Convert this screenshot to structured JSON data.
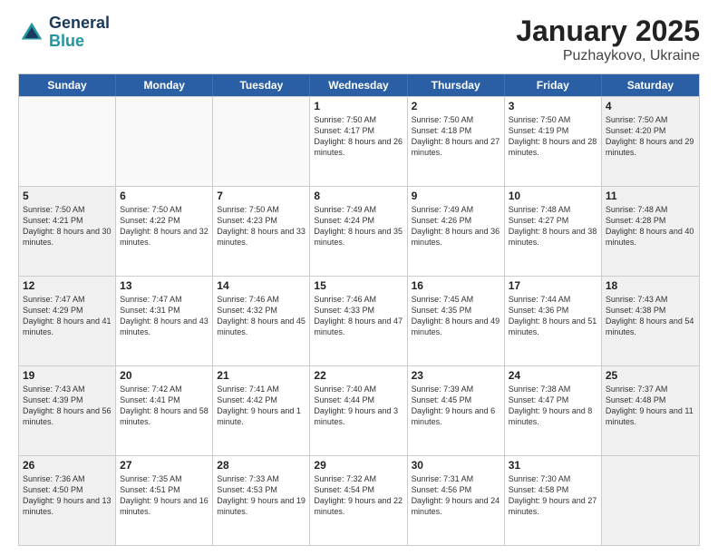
{
  "logo": {
    "line1": "General",
    "line2": "Blue"
  },
  "title": "January 2025",
  "subtitle": "Puzhaykovo, Ukraine",
  "header_days": [
    "Sunday",
    "Monday",
    "Tuesday",
    "Wednesday",
    "Thursday",
    "Friday",
    "Saturday"
  ],
  "rows": [
    [
      {
        "day": "",
        "info": "",
        "shaded": false,
        "empty": true
      },
      {
        "day": "",
        "info": "",
        "shaded": false,
        "empty": true
      },
      {
        "day": "",
        "info": "",
        "shaded": false,
        "empty": true
      },
      {
        "day": "1",
        "info": "Sunrise: 7:50 AM\nSunset: 4:17 PM\nDaylight: 8 hours and 26 minutes.",
        "shaded": false,
        "empty": false
      },
      {
        "day": "2",
        "info": "Sunrise: 7:50 AM\nSunset: 4:18 PM\nDaylight: 8 hours and 27 minutes.",
        "shaded": false,
        "empty": false
      },
      {
        "day": "3",
        "info": "Sunrise: 7:50 AM\nSunset: 4:19 PM\nDaylight: 8 hours and 28 minutes.",
        "shaded": false,
        "empty": false
      },
      {
        "day": "4",
        "info": "Sunrise: 7:50 AM\nSunset: 4:20 PM\nDaylight: 8 hours and 29 minutes.",
        "shaded": true,
        "empty": false
      }
    ],
    [
      {
        "day": "5",
        "info": "Sunrise: 7:50 AM\nSunset: 4:21 PM\nDaylight: 8 hours and 30 minutes.",
        "shaded": true,
        "empty": false
      },
      {
        "day": "6",
        "info": "Sunrise: 7:50 AM\nSunset: 4:22 PM\nDaylight: 8 hours and 32 minutes.",
        "shaded": false,
        "empty": false
      },
      {
        "day": "7",
        "info": "Sunrise: 7:50 AM\nSunset: 4:23 PM\nDaylight: 8 hours and 33 minutes.",
        "shaded": false,
        "empty": false
      },
      {
        "day": "8",
        "info": "Sunrise: 7:49 AM\nSunset: 4:24 PM\nDaylight: 8 hours and 35 minutes.",
        "shaded": false,
        "empty": false
      },
      {
        "day": "9",
        "info": "Sunrise: 7:49 AM\nSunset: 4:26 PM\nDaylight: 8 hours and 36 minutes.",
        "shaded": false,
        "empty": false
      },
      {
        "day": "10",
        "info": "Sunrise: 7:48 AM\nSunset: 4:27 PM\nDaylight: 8 hours and 38 minutes.",
        "shaded": false,
        "empty": false
      },
      {
        "day": "11",
        "info": "Sunrise: 7:48 AM\nSunset: 4:28 PM\nDaylight: 8 hours and 40 minutes.",
        "shaded": true,
        "empty": false
      }
    ],
    [
      {
        "day": "12",
        "info": "Sunrise: 7:47 AM\nSunset: 4:29 PM\nDaylight: 8 hours and 41 minutes.",
        "shaded": true,
        "empty": false
      },
      {
        "day": "13",
        "info": "Sunrise: 7:47 AM\nSunset: 4:31 PM\nDaylight: 8 hours and 43 minutes.",
        "shaded": false,
        "empty": false
      },
      {
        "day": "14",
        "info": "Sunrise: 7:46 AM\nSunset: 4:32 PM\nDaylight: 8 hours and 45 minutes.",
        "shaded": false,
        "empty": false
      },
      {
        "day": "15",
        "info": "Sunrise: 7:46 AM\nSunset: 4:33 PM\nDaylight: 8 hours and 47 minutes.",
        "shaded": false,
        "empty": false
      },
      {
        "day": "16",
        "info": "Sunrise: 7:45 AM\nSunset: 4:35 PM\nDaylight: 8 hours and 49 minutes.",
        "shaded": false,
        "empty": false
      },
      {
        "day": "17",
        "info": "Sunrise: 7:44 AM\nSunset: 4:36 PM\nDaylight: 8 hours and 51 minutes.",
        "shaded": false,
        "empty": false
      },
      {
        "day": "18",
        "info": "Sunrise: 7:43 AM\nSunset: 4:38 PM\nDaylight: 8 hours and 54 minutes.",
        "shaded": true,
        "empty": false
      }
    ],
    [
      {
        "day": "19",
        "info": "Sunrise: 7:43 AM\nSunset: 4:39 PM\nDaylight: 8 hours and 56 minutes.",
        "shaded": true,
        "empty": false
      },
      {
        "day": "20",
        "info": "Sunrise: 7:42 AM\nSunset: 4:41 PM\nDaylight: 8 hours and 58 minutes.",
        "shaded": false,
        "empty": false
      },
      {
        "day": "21",
        "info": "Sunrise: 7:41 AM\nSunset: 4:42 PM\nDaylight: 9 hours and 1 minute.",
        "shaded": false,
        "empty": false
      },
      {
        "day": "22",
        "info": "Sunrise: 7:40 AM\nSunset: 4:44 PM\nDaylight: 9 hours and 3 minutes.",
        "shaded": false,
        "empty": false
      },
      {
        "day": "23",
        "info": "Sunrise: 7:39 AM\nSunset: 4:45 PM\nDaylight: 9 hours and 6 minutes.",
        "shaded": false,
        "empty": false
      },
      {
        "day": "24",
        "info": "Sunrise: 7:38 AM\nSunset: 4:47 PM\nDaylight: 9 hours and 8 minutes.",
        "shaded": false,
        "empty": false
      },
      {
        "day": "25",
        "info": "Sunrise: 7:37 AM\nSunset: 4:48 PM\nDaylight: 9 hours and 11 minutes.",
        "shaded": true,
        "empty": false
      }
    ],
    [
      {
        "day": "26",
        "info": "Sunrise: 7:36 AM\nSunset: 4:50 PM\nDaylight: 9 hours and 13 minutes.",
        "shaded": true,
        "empty": false
      },
      {
        "day": "27",
        "info": "Sunrise: 7:35 AM\nSunset: 4:51 PM\nDaylight: 9 hours and 16 minutes.",
        "shaded": false,
        "empty": false
      },
      {
        "day": "28",
        "info": "Sunrise: 7:33 AM\nSunset: 4:53 PM\nDaylight: 9 hours and 19 minutes.",
        "shaded": false,
        "empty": false
      },
      {
        "day": "29",
        "info": "Sunrise: 7:32 AM\nSunset: 4:54 PM\nDaylight: 9 hours and 22 minutes.",
        "shaded": false,
        "empty": false
      },
      {
        "day": "30",
        "info": "Sunrise: 7:31 AM\nSunset: 4:56 PM\nDaylight: 9 hours and 24 minutes.",
        "shaded": false,
        "empty": false
      },
      {
        "day": "31",
        "info": "Sunrise: 7:30 AM\nSunset: 4:58 PM\nDaylight: 9 hours and 27 minutes.",
        "shaded": false,
        "empty": false
      },
      {
        "day": "",
        "info": "",
        "shaded": true,
        "empty": true
      }
    ]
  ]
}
